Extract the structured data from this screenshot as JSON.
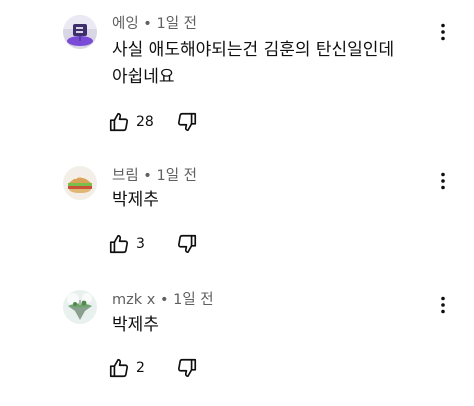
{
  "colors": {
    "meta_text": "#606060",
    "body_text": "#0f0f0f",
    "background": "#ffffff"
  },
  "comments": [
    {
      "author": "에잉",
      "separator": "•",
      "time": "1일 전",
      "lines": [
        "사실 애도해야되는건 김훈의 탄신일인데",
        "아쉽네요"
      ],
      "likes": "28",
      "avatar": "purple-chair-avatar"
    },
    {
      "author": "브림",
      "separator": "•",
      "time": "1일 전",
      "lines": [
        "박제추"
      ],
      "likes": "3",
      "avatar": "sandwich-avatar"
    },
    {
      "author": "mzk x",
      "separator": "•",
      "time": "1일 전",
      "lines": [
        "박제추"
      ],
      "likes": "2",
      "avatar": "floating-island-avatar"
    }
  ],
  "icons": {
    "like": "thumbs-up-icon",
    "dislike": "thumbs-down-icon",
    "menu": "more-vert-icon"
  }
}
